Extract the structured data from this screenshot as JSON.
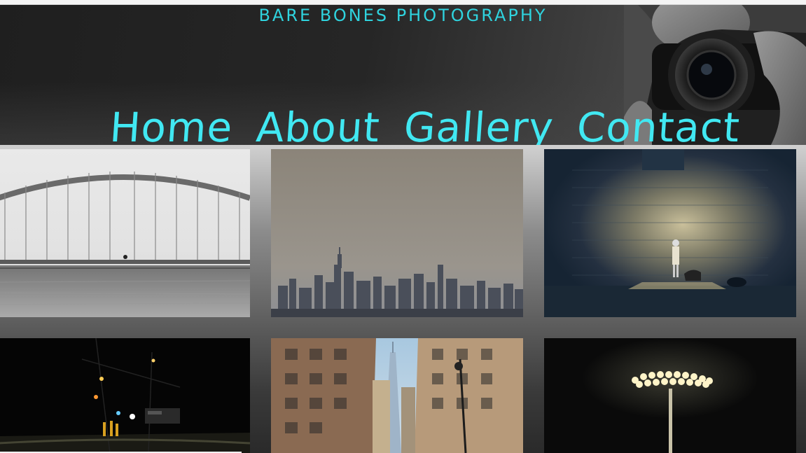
{
  "site": {
    "brand": "BARE BONES PHOTOGRAPHY"
  },
  "nav": {
    "items": [
      {
        "label": "Home"
      },
      {
        "label": "About"
      },
      {
        "label": "Gallery"
      },
      {
        "label": "Contact"
      }
    ]
  },
  "gallery": {
    "photos": [
      {
        "subject": "arch-bridge-over-water"
      },
      {
        "subject": "hazy-city-skyline"
      },
      {
        "subject": "child-with-dog-in-light-beam"
      },
      {
        "subject": "night-street-crew"
      },
      {
        "subject": "downtown-tower-between-buildings"
      },
      {
        "subject": "stadium-light-at-night"
      }
    ]
  },
  "colors": {
    "accent": "#41e8f2",
    "brand_text": "#2fd3de"
  }
}
